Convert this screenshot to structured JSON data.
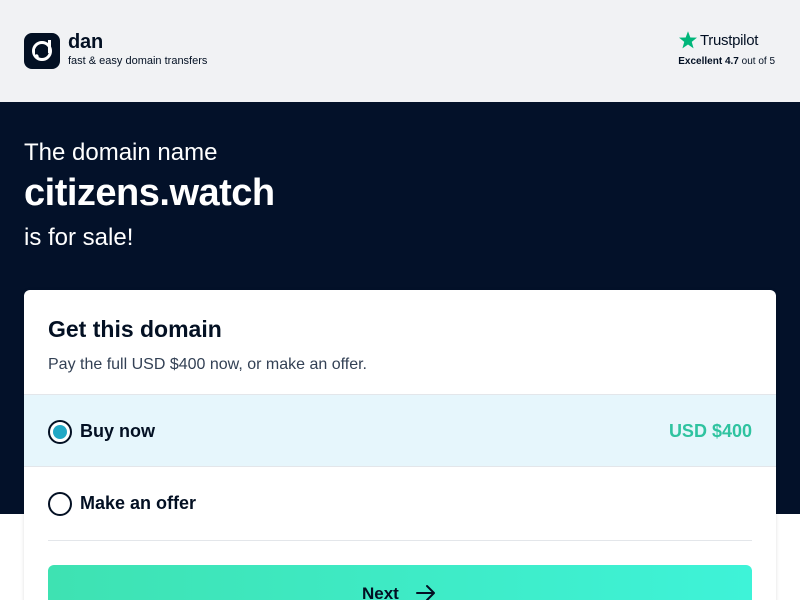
{
  "header": {
    "brand_name": "dan",
    "tagline": "fast & easy domain transfers",
    "trustpilot": {
      "name": "Trustpilot",
      "rating_word": "Excellent",
      "score": "4.7",
      "out_of": "out of 5"
    }
  },
  "hero": {
    "line1": "The domain name",
    "domain": "citizens.watch",
    "line3": "is for sale!"
  },
  "card": {
    "title": "Get this domain",
    "subtitle": "Pay the full USD $400 now, or make an offer.",
    "options": [
      {
        "label": "Buy now",
        "price": "USD $400",
        "selected": true
      },
      {
        "label": "Make an offer",
        "selected": false
      }
    ],
    "next_label": "Next"
  },
  "colors": {
    "hero_bg": "#031129",
    "header_bg": "#f1f2f4",
    "accent_green": "#2fc3a0",
    "radio_fill": "#22a8c5",
    "trustpilot_green": "#00b67a"
  },
  "icons": [
    "dan-logo-icon",
    "trustpilot-star-icon",
    "arrow-right-icon"
  ]
}
